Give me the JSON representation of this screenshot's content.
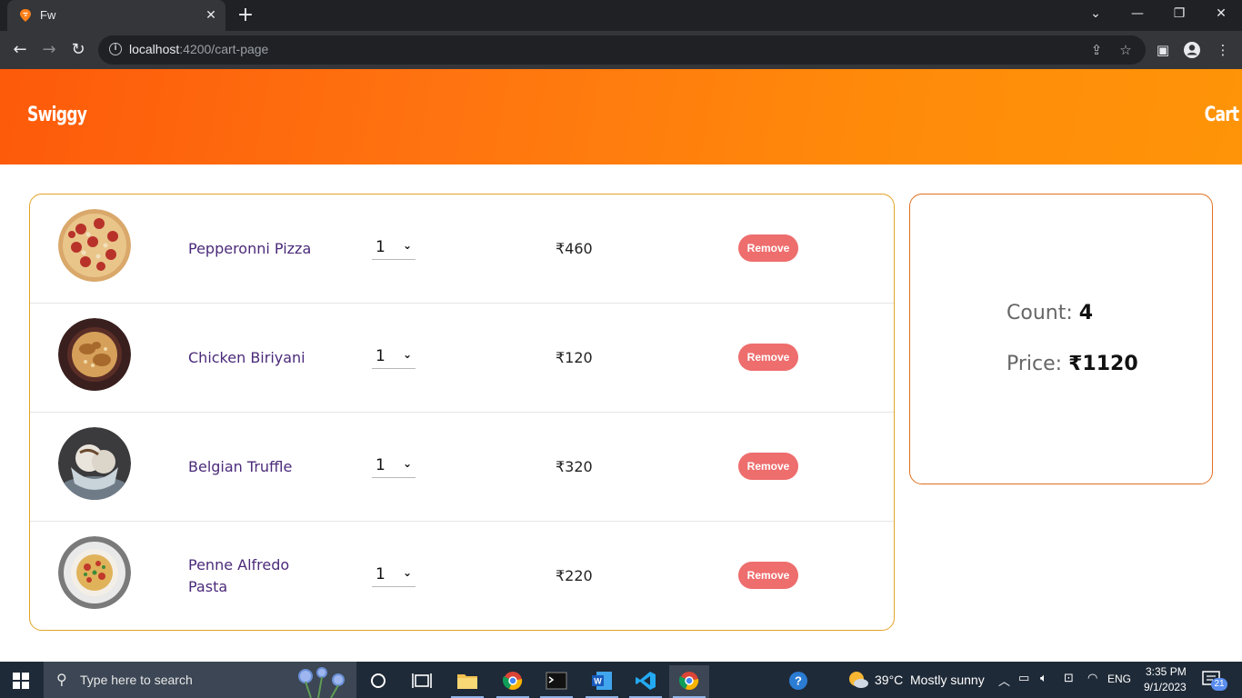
{
  "browser": {
    "tab_title": "Fw",
    "url_host": "localhost",
    "url_path": ":4200/cart-page"
  },
  "header": {
    "brand": "Swiggy",
    "cart_link": "Cart"
  },
  "cart": {
    "items": [
      {
        "name": "Pepperonni Pizza",
        "quantity": "1",
        "price": "₹460",
        "remove_label": "Remove",
        "image": "pizza"
      },
      {
        "name": "Chicken Biriyani",
        "quantity": "1",
        "price": "₹120",
        "remove_label": "Remove",
        "image": "biryani"
      },
      {
        "name": "Belgian Truffle",
        "quantity": "1",
        "price": "₹320",
        "remove_label": "Remove",
        "image": "ice-cream"
      },
      {
        "name": "Penne Alfredo Pasta",
        "quantity": "1",
        "price": "₹220",
        "remove_label": "Remove",
        "image": "pasta"
      }
    ]
  },
  "summary": {
    "count_label": "Count:",
    "count_value": "4",
    "price_label": "Price:",
    "price_value": "₹1120"
  },
  "taskbar": {
    "search_placeholder": "Type here to search",
    "weather_temp": "39°C",
    "weather_desc": "Mostly sunny",
    "language": "ENG",
    "time": "3:35 PM",
    "date": "9/1/2023",
    "notification_count": "21"
  },
  "colors": {
    "header_gradient_start": "#fd5a0a",
    "header_gradient_end": "#ff9408",
    "remove_button": "#ee6d6d",
    "item_name": "#4b2a7a",
    "list_border": "#e3a327",
    "summary_border": "#e07020"
  }
}
